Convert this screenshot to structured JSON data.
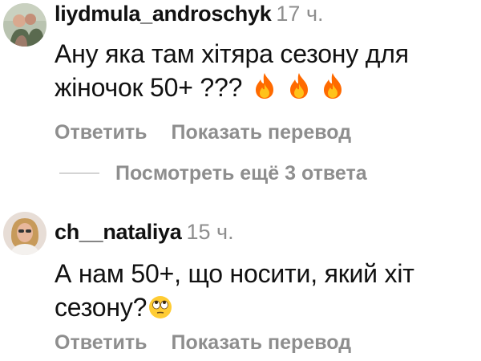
{
  "comments": [
    {
      "username": "liydmula_androschyk",
      "time": "17 ч.",
      "text": "Ану яка там хітяра сезону  для жіночок 50+ ???",
      "emojis": [
        "fire-emoji",
        "fire-emoji",
        "fire-emoji"
      ],
      "reply_label": "Ответить",
      "translate_label": "Показать перевод"
    },
    {
      "username": "ch__nataliya",
      "time": "15 ч.",
      "text": "А нам 50+, що носити, який хіт сезону?",
      "emojis": [
        "eye-roll-emoji"
      ],
      "reply_label": "Ответить",
      "translate_label": "Показать перевод"
    }
  ],
  "view_more_replies": "Посмотреть ещё 3 ответа",
  "colors": {
    "text": "#111111",
    "secondary": "#8e8e8e",
    "divider": "#d4d4d4",
    "fire": "#ff6a00"
  }
}
